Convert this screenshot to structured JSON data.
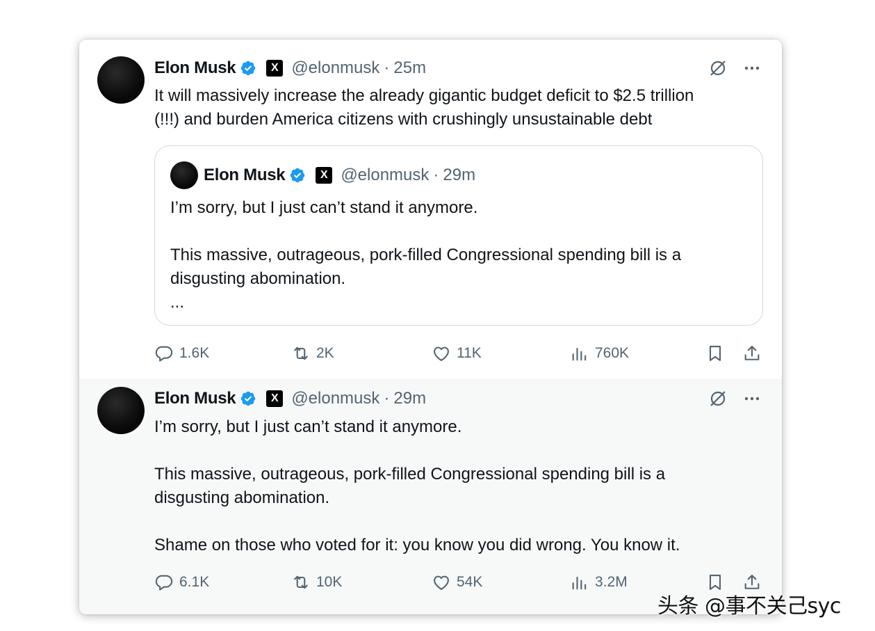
{
  "tweets": [
    {
      "author": {
        "name": "Elon Musk",
        "handle": "@elonmusk",
        "verified": true,
        "affiliate_badge": "X"
      },
      "separator": "·",
      "time": "25m",
      "text": "It will massively increase the already gigantic budget deficit to $2.5 trillion\n(!!!) and burden America citizens with crushingly unsustainable debt",
      "quote": {
        "author": {
          "name": "Elon Musk",
          "handle": "@elonmusk",
          "verified": true,
          "affiliate_badge": "X"
        },
        "separator": "·",
        "time": "29m",
        "text": "I’m sorry, but I just can’t stand it anymore.\n\nThis massive, outrageous, pork-filled Congressional spending bill is a\ndisgusting abomination.\n..."
      },
      "stats": {
        "replies": "1.6K",
        "reposts": "2K",
        "likes": "11K",
        "views": "760K"
      }
    },
    {
      "author": {
        "name": "Elon Musk",
        "handle": "@elonmusk",
        "verified": true,
        "affiliate_badge": "X"
      },
      "separator": "·",
      "time": "29m",
      "text": "I’m sorry, but I just can’t stand it anymore.\n\nThis massive, outrageous, pork-filled Congressional spending bill is a\ndisgusting abomination.\n\nShame on those who voted for it: you know you did wrong. You know it.",
      "stats": {
        "replies": "6.1K",
        "reposts": "10K",
        "likes": "54K",
        "views": "3.2M"
      }
    }
  ],
  "icons": {
    "verified": "verified-badge-icon",
    "grok": "grok-icon",
    "more": "more-icon",
    "reply": "reply-icon",
    "repost": "repost-icon",
    "like": "heart-icon",
    "views": "views-icon",
    "bookmark": "bookmark-icon",
    "share": "share-icon"
  },
  "colors": {
    "verified_blue": "#1d9bf0",
    "secondary_text": "#536471",
    "primary_text": "#0f1419"
  },
  "watermark": "头条 @事不关己syc"
}
